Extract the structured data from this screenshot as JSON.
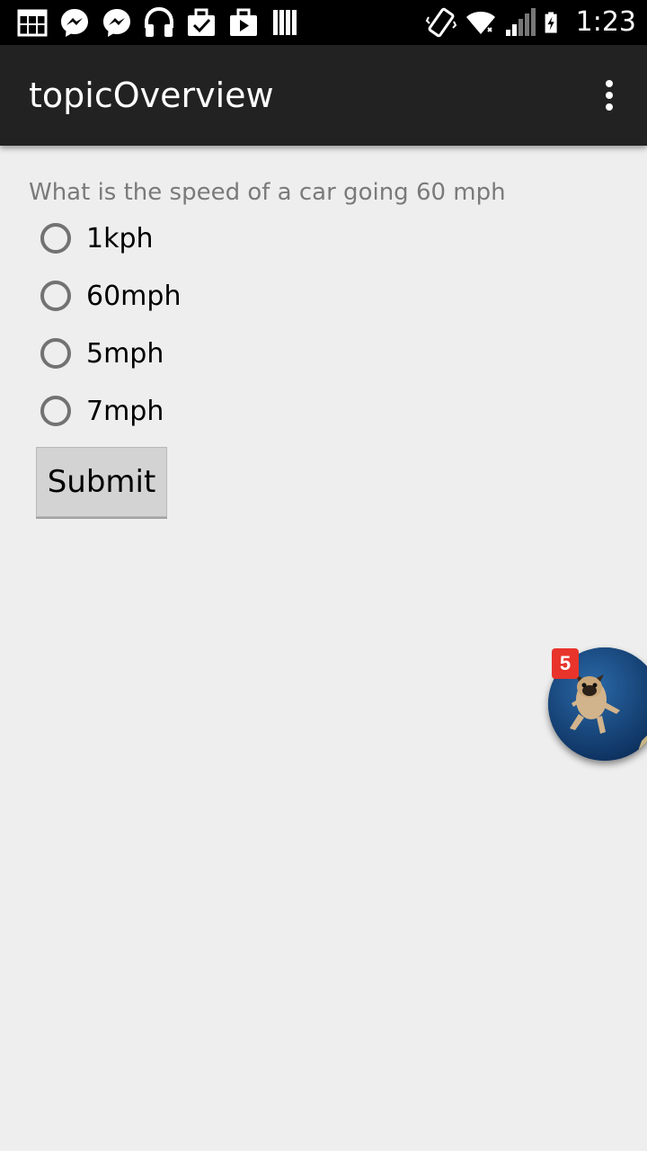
{
  "status_bar": {
    "time": "1:23",
    "left_icons": [
      "calendar-icon",
      "messenger-icon",
      "messenger-icon",
      "headphones-icon",
      "briefcase-check-icon",
      "briefcase-play-icon",
      "library-icon"
    ],
    "right_icons": [
      "vibrate-icon",
      "wifi-icon",
      "signal-icon",
      "battery-charging-icon"
    ]
  },
  "action_bar": {
    "title": "topicOverview",
    "menu_icon": "more-vertical-icon"
  },
  "quiz": {
    "question": "What is the speed of a car going 60 mph",
    "options": [
      {
        "label": "1kph",
        "selected": false
      },
      {
        "label": "60mph",
        "selected": false
      },
      {
        "label": "5mph",
        "selected": false
      },
      {
        "label": "7mph",
        "selected": false
      }
    ],
    "submit_label": "Submit"
  },
  "chat_head": {
    "badge_count": "5",
    "avatar_icon": "pug-avatar-icon"
  },
  "colors": {
    "status_bar": "#000000",
    "action_bar": "#222222",
    "background": "#eeeeee",
    "badge": "#e8342b",
    "radio_border": "#727272",
    "question_text": "#7a7a7a"
  }
}
